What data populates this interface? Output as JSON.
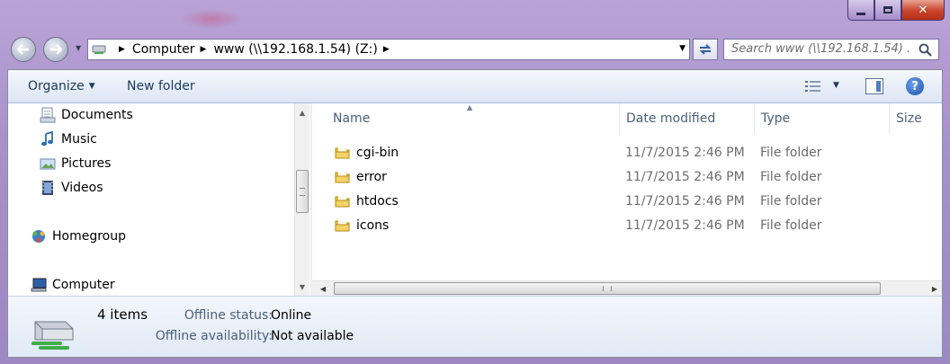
{
  "window": {
    "caption_buttons": [
      "minimize",
      "maximize",
      "close"
    ]
  },
  "address_bar": {
    "crumbs": [
      "Computer",
      "www (\\\\192.168.1.54) (Z:)"
    ]
  },
  "search": {
    "placeholder": "Search www (\\\\192.168.1.54) ..."
  },
  "toolbar": {
    "organize_label": "Organize",
    "new_folder_label": "New folder"
  },
  "nav_pane": {
    "items": [
      {
        "label": "Documents",
        "icon": "documents-icon"
      },
      {
        "label": "Music",
        "icon": "music-icon"
      },
      {
        "label": "Pictures",
        "icon": "pictures-icon"
      },
      {
        "label": "Videos",
        "icon": "videos-icon"
      },
      {
        "label": "Homegroup",
        "icon": "homegroup-icon"
      },
      {
        "label": "Computer",
        "icon": "computer-icon"
      }
    ]
  },
  "file_list": {
    "columns": [
      "Name",
      "Date modified",
      "Type",
      "Size"
    ],
    "rows": [
      {
        "name": "cgi-bin",
        "date": "11/7/2015 2:46 PM",
        "type": "File folder"
      },
      {
        "name": "error",
        "date": "11/7/2015 2:46 PM",
        "type": "File folder"
      },
      {
        "name": "htdocs",
        "date": "11/7/2015 2:46 PM",
        "type": "File folder"
      },
      {
        "name": "icons",
        "date": "11/7/2015 2:46 PM",
        "type": "File folder"
      }
    ]
  },
  "details": {
    "item_count": "4 items",
    "offline_status_label": "Offline status:",
    "offline_status_value": "Online",
    "offline_availability_label": "Offline availability:",
    "offline_availability_value": "Not available"
  },
  "colors": {
    "title_bar": "#a791c9",
    "toolbar": "#e7eef8",
    "close_button": "#c9442a",
    "folder": "#e8c24a"
  }
}
